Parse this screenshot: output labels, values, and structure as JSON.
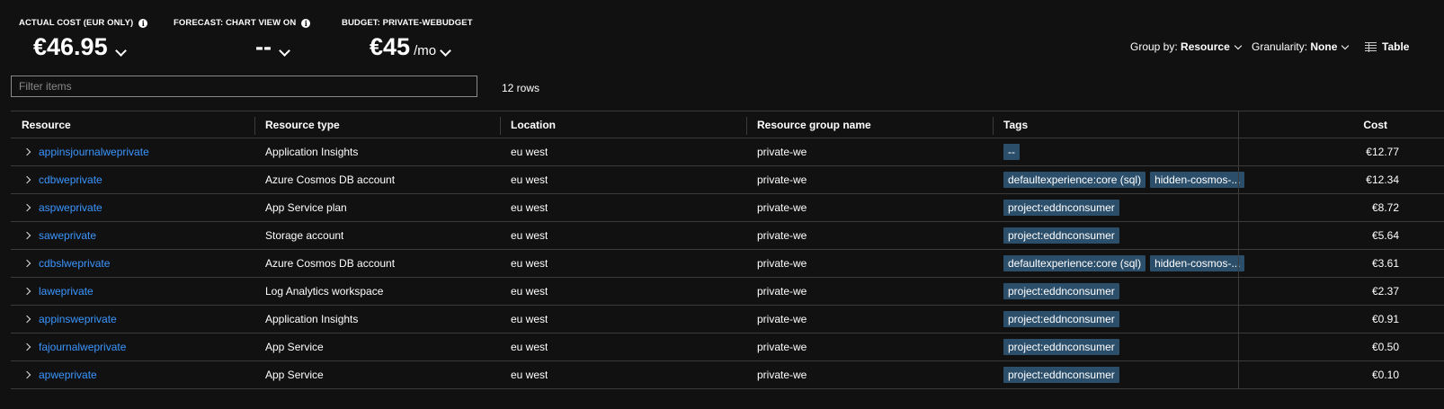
{
  "kpis": {
    "actual": {
      "label": "ACTUAL COST (EUR ONLY)",
      "value": "€46.95"
    },
    "forecast": {
      "label": "FORECAST: CHART VIEW ON",
      "value": "--"
    },
    "budget": {
      "label": "BUDGET: PRIVATE-WEBUDGET",
      "value": "€45",
      "unit": "/mo"
    }
  },
  "toolbar": {
    "group_by_label": "Group by:",
    "group_by_value": "Resource",
    "granularity_label": "Granularity:",
    "granularity_value": "None",
    "view_label": "Table"
  },
  "filter": {
    "placeholder": "Filter items",
    "value": ""
  },
  "row_count": "12 rows",
  "table": {
    "headers": {
      "resource": "Resource",
      "type": "Resource type",
      "location": "Location",
      "group": "Resource group name",
      "tags": "Tags",
      "cost": "Cost"
    },
    "rows": [
      {
        "resource": "appinsjournalweprivate",
        "type": "Application Insights",
        "location": "eu west",
        "group": "private-we",
        "tags": [
          "--"
        ],
        "cost": "€12.77"
      },
      {
        "resource": "cdbweprivate",
        "type": "Azure Cosmos DB account",
        "location": "eu west",
        "group": "private-we",
        "tags": [
          "defaultexperience:core (sql)",
          "hidden-cosmos-..."
        ],
        "cost": "€12.34"
      },
      {
        "resource": "aspweprivate",
        "type": "App Service plan",
        "location": "eu west",
        "group": "private-we",
        "tags": [
          "project:eddnconsumer"
        ],
        "cost": "€8.72"
      },
      {
        "resource": "saweprivate",
        "type": "Storage account",
        "location": "eu west",
        "group": "private-we",
        "tags": [
          "project:eddnconsumer"
        ],
        "cost": "€5.64"
      },
      {
        "resource": "cdbslweprivate",
        "type": "Azure Cosmos DB account",
        "location": "eu west",
        "group": "private-we",
        "tags": [
          "defaultexperience:core (sql)",
          "hidden-cosmos-..."
        ],
        "cost": "€3.61"
      },
      {
        "resource": "laweprivate",
        "type": "Log Analytics workspace",
        "location": "eu west",
        "group": "private-we",
        "tags": [
          "project:eddnconsumer"
        ],
        "cost": "€2.37"
      },
      {
        "resource": "appinsweprivate",
        "type": "Application Insights",
        "location": "eu west",
        "group": "private-we",
        "tags": [
          "project:eddnconsumer"
        ],
        "cost": "€0.91"
      },
      {
        "resource": "fajournalweprivate",
        "type": "App Service",
        "location": "eu west",
        "group": "private-we",
        "tags": [
          "project:eddnconsumer"
        ],
        "cost": "€0.50"
      },
      {
        "resource": "apweprivate",
        "type": "App Service",
        "location": "eu west",
        "group": "private-we",
        "tags": [
          "project:eddnconsumer"
        ],
        "cost": "€0.10"
      }
    ]
  }
}
